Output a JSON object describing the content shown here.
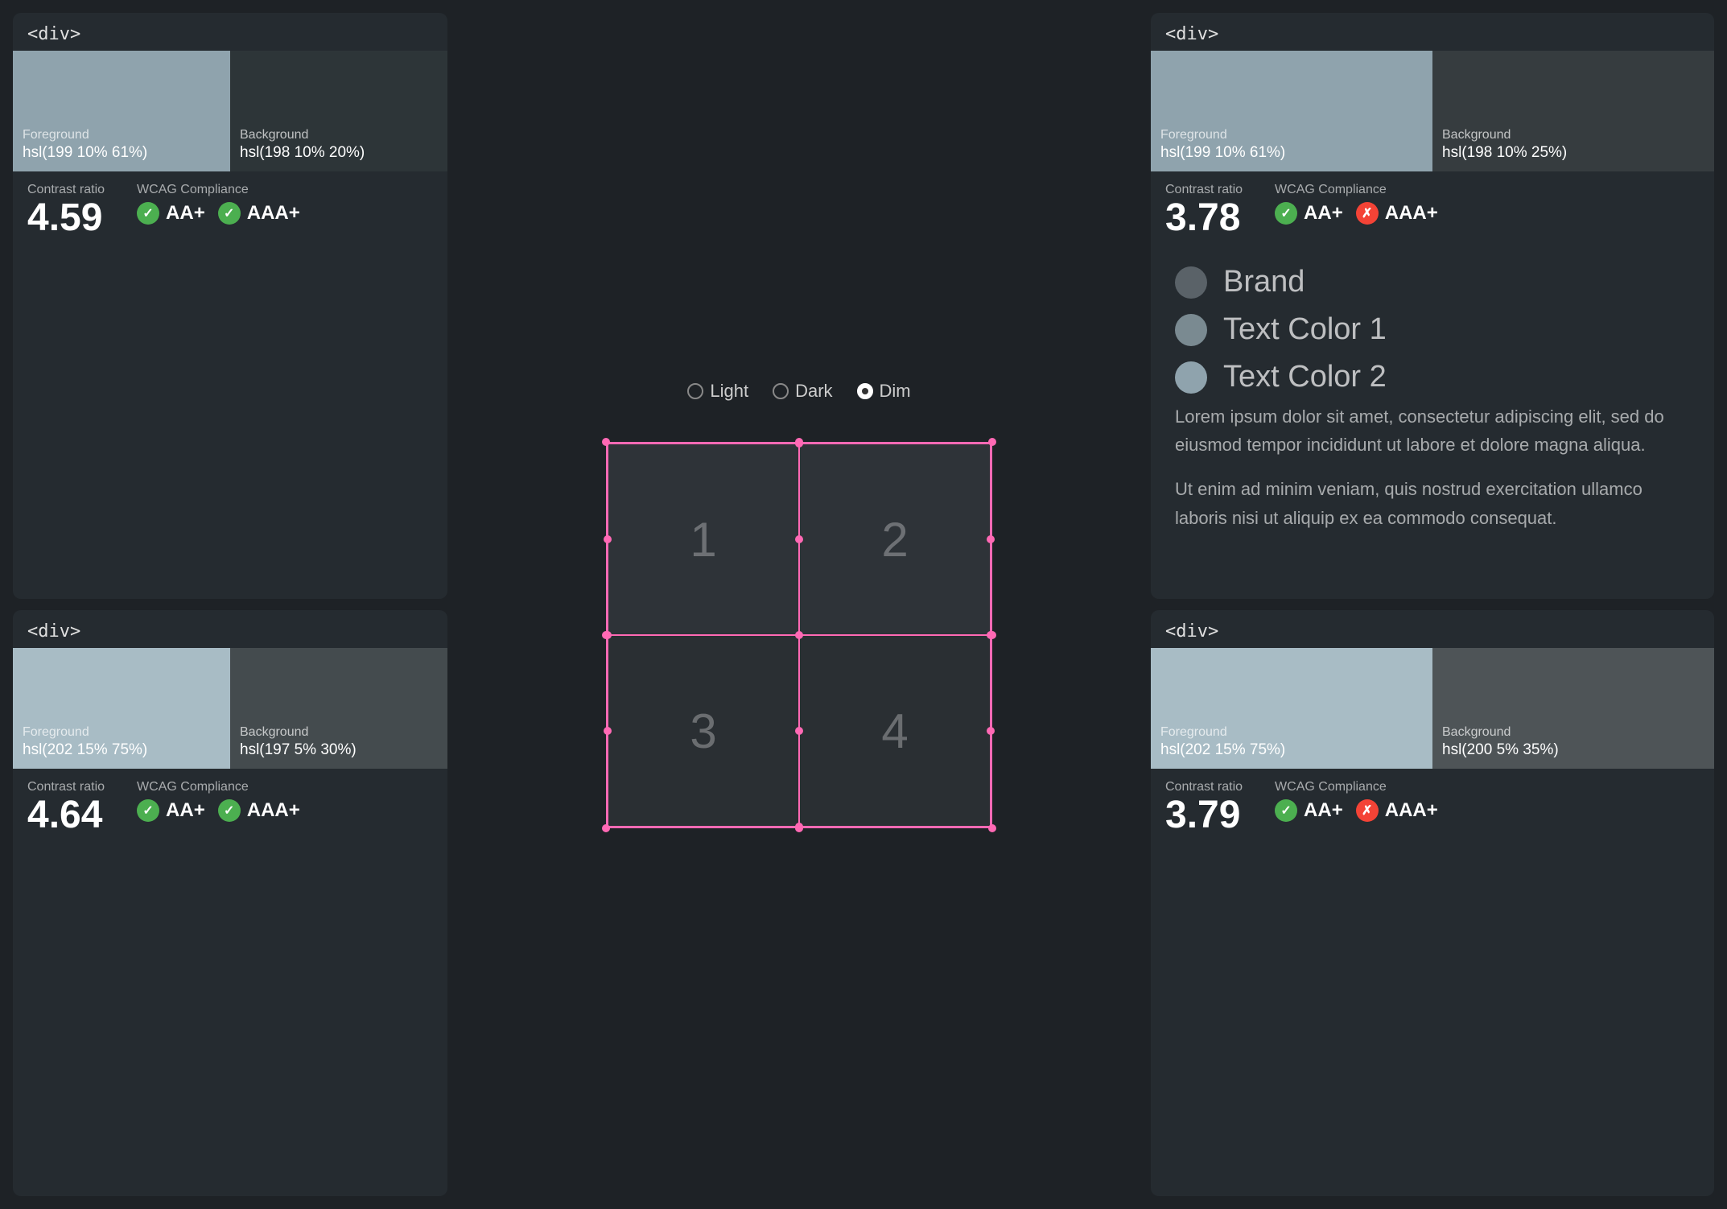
{
  "panels": {
    "top_left": {
      "tag": "<div>",
      "foreground_label": "Foreground",
      "foreground_value": "hsl(199 10% 61%)",
      "background_label": "Background",
      "background_value": "hsl(198 10% 20%)",
      "foreground_color": "#8fa3ad",
      "background_color": "#2d3336",
      "contrast_label": "Contrast ratio",
      "contrast_value": "4.59",
      "wcag_label": "WCAG Compliance",
      "aa_label": "AA+",
      "aaa_label": "AAA+",
      "aa_pass": true,
      "aaa_pass": true
    },
    "top_right": {
      "tag": "<div>",
      "foreground_label": "Foreground",
      "foreground_value": "hsl(199 10% 61%)",
      "background_label": "Background",
      "background_value": "hsl(198 10% 25%)",
      "foreground_color": "#8fa3ad",
      "background_color": "#353b3e",
      "contrast_label": "Contrast ratio",
      "contrast_value": "3.78",
      "wcag_label": "WCAG Compliance",
      "aa_label": "AA+",
      "aaa_label": "AAA+",
      "aa_pass": true,
      "aaa_pass": false
    },
    "bottom_left": {
      "tag": "<div>",
      "foreground_label": "Foreground",
      "foreground_value": "hsl(202 15% 75%)",
      "background_label": "Background",
      "background_value": "hsl(197 5% 30%)",
      "foreground_color": "#a8bcc5",
      "background_color": "#444b4e",
      "contrast_label": "Contrast ratio",
      "contrast_value": "4.64",
      "wcag_label": "WCAG Compliance",
      "aa_label": "AA+",
      "aaa_label": "AAA+",
      "aa_pass": true,
      "aaa_pass": true
    },
    "bottom_right": {
      "tag": "<div>",
      "foreground_label": "Foreground",
      "foreground_value": "hsl(202 15% 75%)",
      "background_label": "Background",
      "background_value": "hsl(200 5% 35%)",
      "foreground_color": "#a8bcc5",
      "background_color": "#4e5457",
      "contrast_label": "Contrast ratio",
      "contrast_value": "3.79",
      "wcag_label": "WCAG Compliance",
      "aa_label": "AA+",
      "aaa_label": "AAA+",
      "aa_pass": true,
      "aaa_pass": false
    }
  },
  "theme_selector": {
    "options": [
      "Light",
      "Dark",
      "Dim"
    ],
    "selected": "Dim"
  },
  "grid": {
    "cells": [
      "1",
      "2",
      "3",
      "4"
    ]
  },
  "legend": {
    "items": [
      {
        "label": "Brand",
        "color": "#5a6268"
      },
      {
        "label": "Text Color 1",
        "color": "#7a8a91"
      },
      {
        "label": "Text Color 2",
        "color": "#8fa3ad"
      }
    ]
  },
  "lorem": {
    "p1": "Lorem ipsum dolor sit amet, consectetur adipiscing elit, sed do eiusmod tempor incididunt ut labore et dolore magna aliqua.",
    "p2": "Ut enim ad minim veniam, quis nostrud exercitation ullamco laboris nisi ut aliquip ex ea commodo consequat."
  }
}
